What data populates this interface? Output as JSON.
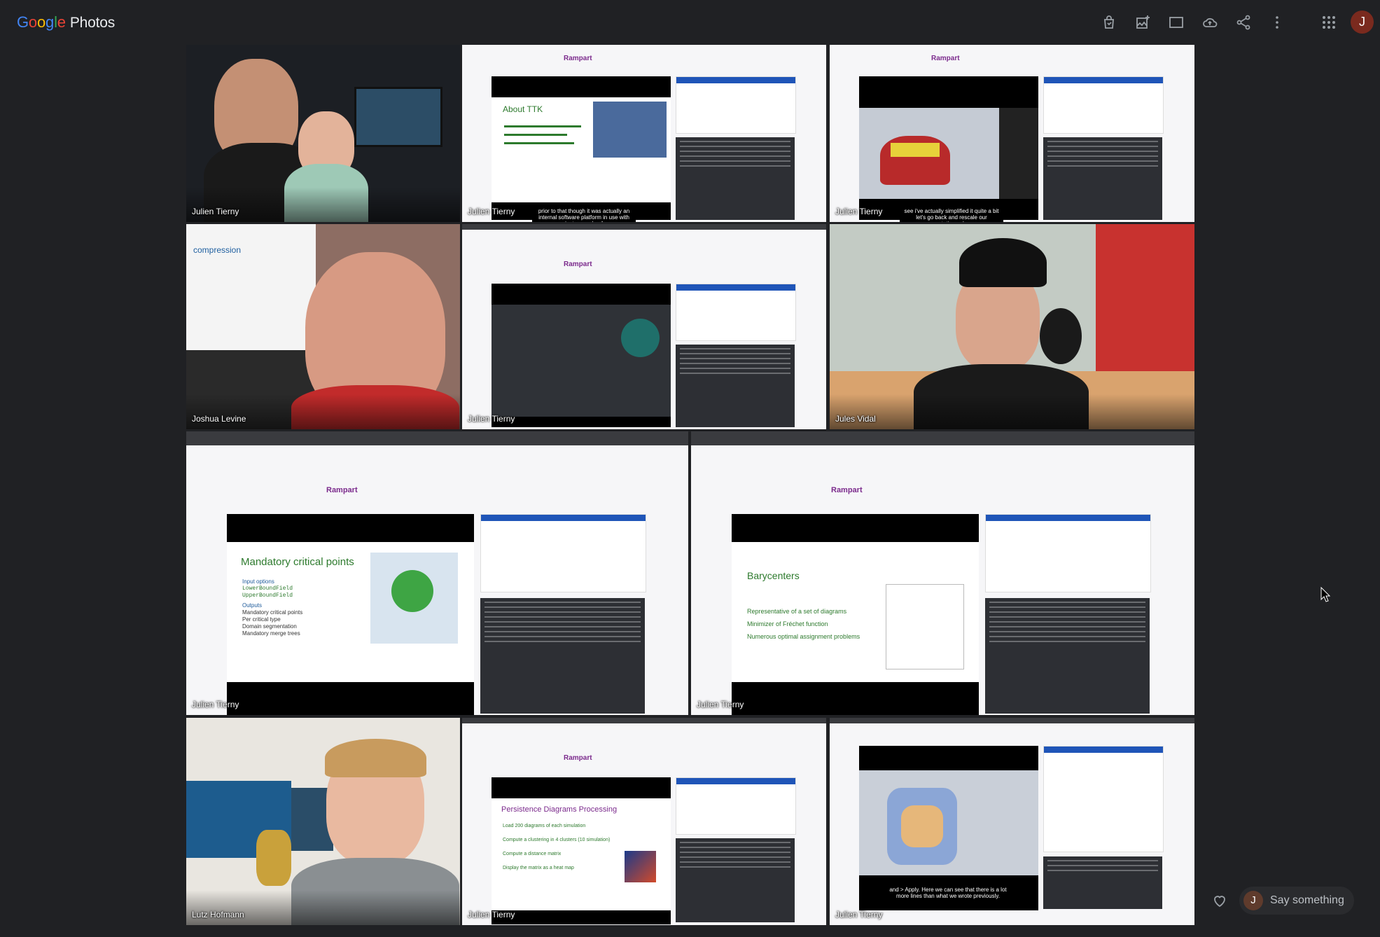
{
  "app": {
    "logo_google": [
      "G",
      "o",
      "o",
      "g",
      "l",
      "e"
    ],
    "logo_product": "Photos",
    "avatar_letter": "J"
  },
  "toolbar": {
    "icons": [
      "shopping-bag-icon",
      "add-to-album-icon",
      "slideshow-icon",
      "backup-cloud-icon",
      "share-icon",
      "more-vert-icon",
      "apps-grid-icon"
    ]
  },
  "tiles": [
    {
      "caption": "Julien Tierny"
    },
    {
      "caption": "Julien Tierny",
      "slide_title": "About TTK",
      "page_title": "Rampart",
      "subtitle": "prior to that though it was actually an internal software platform in use with just a couple of"
    },
    {
      "caption": "Julien Tierny",
      "page_title": "Rampart",
      "subtitle": "see i've actually simplified it quite a bit let's go back and rescale our segmentation color map"
    },
    {
      "caption": "Joshua Levine",
      "slide_text": "compression"
    },
    {
      "caption": "Julien Tierny",
      "page_title": "Rampart"
    },
    {
      "caption": "Jules Vidal"
    },
    {
      "caption": "Julien Tierny",
      "page_title": "Rampart",
      "slide_title": "Mandatory critical points",
      "bullets": [
        "Input options",
        "LowerBoundField",
        "UpperBoundField",
        "Outputs",
        "Mandatory critical points",
        "Per critical type",
        "Domain segmentation",
        "Mandatory merge trees"
      ]
    },
    {
      "caption": "Julien Tierny",
      "page_title": "Rampart",
      "slide_title": "Barycenters",
      "bullets": [
        "Representative of a set of diagrams",
        "Minimizer of Fréchet function",
        "Numerous optimal assignment problems"
      ]
    },
    {
      "caption": "Lutz Hofmann"
    },
    {
      "caption": "Julien Tierny",
      "page_title": "Rampart",
      "slide_title": "Persistence Diagrams Processing",
      "bullets": [
        "Load 200 diagrams of each simulation",
        "Compute a clustering in 4 clusters (10 simulation)",
        "Compute a distance matrix",
        "Display the matrix as a heat map"
      ]
    },
    {
      "caption": "Julien Tierny",
      "subtitle": "and > Apply. Here we can see that there is a lot more lines than what we wrote previously."
    }
  ],
  "comment": {
    "avatar_letter": "J",
    "placeholder": "Say something"
  },
  "colors": {
    "background": "#202124",
    "accent_green": "#2d7a2d",
    "rampart_purple": "#7b2a8c"
  }
}
